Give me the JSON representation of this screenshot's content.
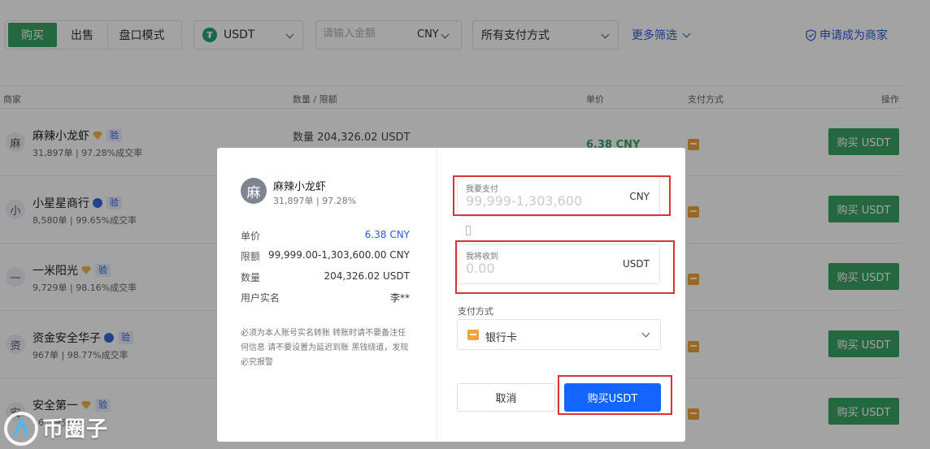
{
  "topbar": {
    "tabs": [
      "购买",
      "出售",
      "盘口模式"
    ],
    "coin": "USDT",
    "coin_icon": "tether-icon",
    "amount_placeholder": "请输入金额",
    "currency": "CNY",
    "payment_filter": "所有支付方式",
    "more_filters": "更多筛选",
    "apply_merchant": "申请成为商家"
  },
  "table": {
    "headers": {
      "merchant": "商家",
      "quantity": "数量 / 限额",
      "price": "单价",
      "payment": "支付方式",
      "action": "操作"
    },
    "rows": [
      {
        "avatar": "麻",
        "name": "麻辣小龙虾",
        "badge": "gem",
        "verify": "验",
        "stats": "31,897单 | 97.28%成交率",
        "qty": "数量   204,326.02 USDT",
        "price": "6.38 CNY",
        "buy": "购买 USDT"
      },
      {
        "avatar": "小",
        "name": "小星星商行",
        "badge": "verified",
        "verify": "验",
        "stats": "8,580单 | 99.65%成交率",
        "qty": "",
        "price": "",
        "buy": "购买 USDT"
      },
      {
        "avatar": "一",
        "name": "一米阳光",
        "badge": "gem",
        "verify": "验",
        "stats": "9,729单 | 98.16%成交率",
        "qty": "",
        "price": "",
        "buy": "购买 USDT"
      },
      {
        "avatar": "资",
        "name": "资金安全华子",
        "badge": "verified",
        "verify": "验",
        "stats": "967单 | 98.77%成交率",
        "qty": "",
        "price": "",
        "buy": "购买 USDT"
      },
      {
        "avatar": "安",
        "name": "安全第一",
        "badge": "gem",
        "verify": "验",
        "stats": "16...成交率",
        "qty": "",
        "price": "",
        "buy": "购买 USDT"
      }
    ]
  },
  "modal": {
    "avatar": "麻",
    "merchant_name": "麻辣小龙虾",
    "merchant_stats": "31,897单 | 97.28%",
    "price_label": "单价",
    "price_value": "6.38 CNY",
    "limit_label": "限额",
    "limit_value": "99,999.00-1,303,600.00 CNY",
    "quantity_label": "数量",
    "quantity_value": "204,326.02 USDT",
    "realname_label": "用户实名",
    "realname_value": "李**",
    "notice": "必须为本人账号实名转账 转账时请不要备注任何信息 请不要设置为延迟到账 黑钱绕道，发现必究报警",
    "pay_label": "我要支付",
    "pay_placeholder": "99,999-1,303,600",
    "pay_currency": "CNY",
    "receive_label": "我将收到",
    "receive_placeholder": "0.00",
    "receive_currency": "USDT",
    "payment_method_label": "支付方式",
    "payment_method_value": "银行卡",
    "cancel": "取消",
    "confirm": "购买USDT"
  },
  "watermark": {
    "text": "币圈子"
  },
  "colors": {
    "primary_green": "#3ba163",
    "link_blue": "#2d5bd6",
    "confirm_blue": "#1464ff",
    "highlight_red": "#d73434",
    "payment_orange": "#f0a33c"
  }
}
